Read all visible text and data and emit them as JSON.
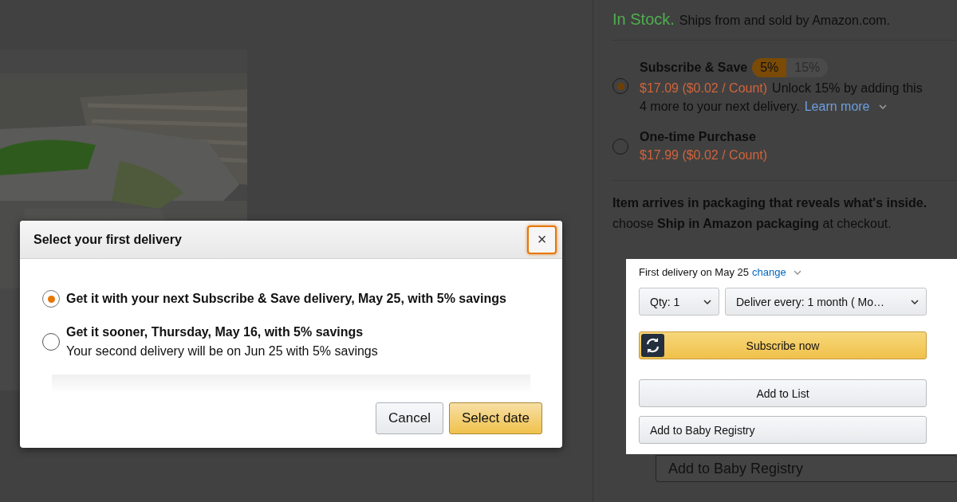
{
  "product_page": {
    "availability": {
      "status": "In Stock.",
      "seller": "Ships from and sold by Amazon.com."
    },
    "purchase_options": [
      {
        "title": "Subscribe & Save",
        "selected": true,
        "discount_tiers": [
          {
            "label": "5%",
            "selected": true
          },
          {
            "label": "15%",
            "selected": false
          }
        ],
        "price": "$17.09 ($0.02 / Count)",
        "note": "Unlock 15% by adding this",
        "note_line_2": "4 more to your next delivery.",
        "link": "Learn more"
      },
      {
        "title": "One-time Purchase",
        "selected": false,
        "price": "$17.99 ($0.02 / Count)"
      }
    ],
    "packaging_notice": {
      "line_1": "Item arrives in packaging that reveals what's inside.",
      "line_2": "choose **Ship in Amazon packaging** at checkout."
    },
    "registry_button": "Add to Baby Registry"
  },
  "dialog": {
    "title": "Select your first delivery",
    "close": "×",
    "options": [
      {
        "label": "Get it with your next Subscribe & Save delivery, May 25, with 5% savings",
        "selected": true
      },
      {
        "label": "Get it sooner, Thursday, May 16, with 5% savings",
        "detail": "Your second delivery will be on Jun 25 with 5% savings",
        "selected": false
      }
    ],
    "buttons": [
      {
        "label": "Cancel",
        "kind": "secondary"
      },
      {
        "label": "Select date",
        "kind": "primary"
      }
    ]
  },
  "inset_panel": {
    "first_delivery": "First delivery on May 25",
    "change_link": "change",
    "selects": [
      {
        "label": "Qty:",
        "value": "1"
      },
      {
        "label": "Deliver every:",
        "value": "1 month ( Mo…"
      }
    ],
    "buttons": [
      {
        "label": "Subscribe now",
        "kind": "subscribe"
      },
      {
        "label": "Add to List",
        "kind": "plain"
      },
      {
        "label": "Add to Baby Registry",
        "kind": "left"
      }
    ]
  }
}
